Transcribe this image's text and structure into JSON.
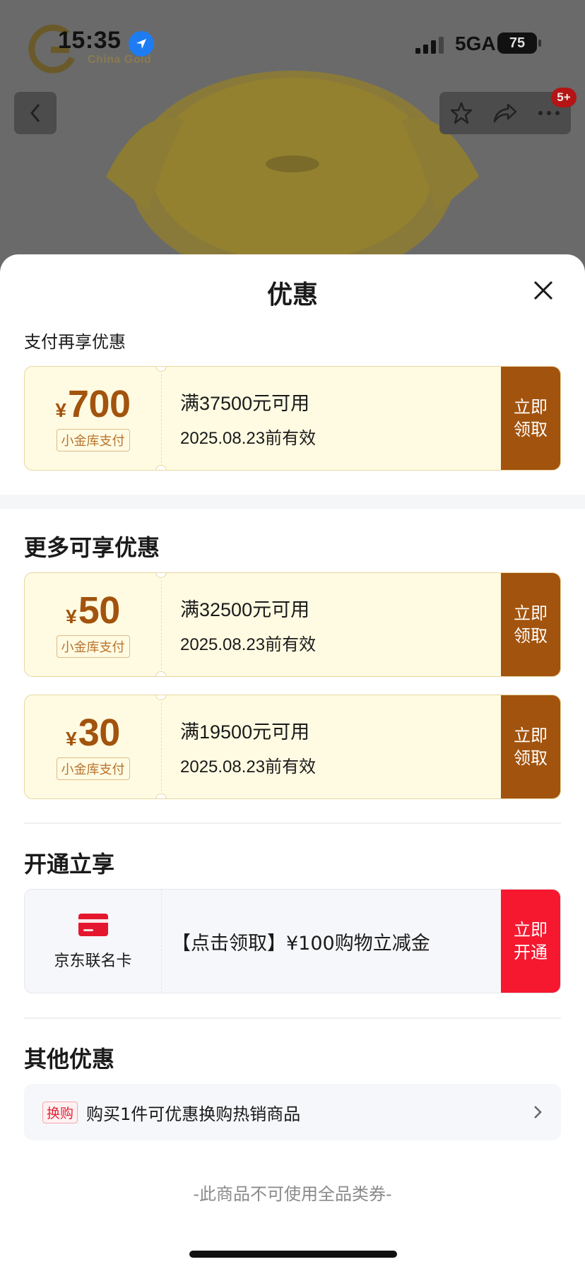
{
  "status_bar": {
    "time": "15:35",
    "network": "5GA",
    "battery": "75"
  },
  "background": {
    "brand_text": "China Gold",
    "more_badge": "5+"
  },
  "sheet": {
    "title": "优惠",
    "pay_section": {
      "label": "支付再享优惠",
      "coupons": [
        {
          "currency": "¥",
          "amount": "700",
          "tag": "小金库支付",
          "condition": "满37500元可用",
          "validity": "2025.08.23前有效",
          "button": "立即领取"
        }
      ]
    },
    "more_section": {
      "label": "更多可享优惠",
      "coupons": [
        {
          "currency": "¥",
          "amount": "50",
          "tag": "小金库支付",
          "condition": "满32500元可用",
          "validity": "2025.08.23前有效",
          "button": "立即领取"
        },
        {
          "currency": "¥",
          "amount": "30",
          "tag": "小金库支付",
          "condition": "满19500元可用",
          "validity": "2025.08.23前有效",
          "button": "立即领取"
        }
      ]
    },
    "open_section": {
      "label": "开通立享",
      "card_name": "京东联名卡",
      "offer": "【点击领取】¥100购物立减金",
      "button": "立即开通"
    },
    "other_section": {
      "label": "其他优惠",
      "badge": "换购",
      "text": "购买1件可优惠换购热销商品"
    },
    "footer_note": "-此商品不可使用全品类券-"
  },
  "colors": {
    "coupon_accent": "#a2530d",
    "coupon_bg": "#fffbe2",
    "card_button": "#f5182f",
    "badge_red": "#e2233a"
  },
  "icons": {
    "back": "chevron-left-icon",
    "favorite": "star-icon",
    "share": "share-icon",
    "more": "more-dots-icon",
    "close": "close-icon",
    "card": "credit-card-icon",
    "row_arrow": "chevron-right-icon",
    "location": "location-arrow-icon"
  }
}
